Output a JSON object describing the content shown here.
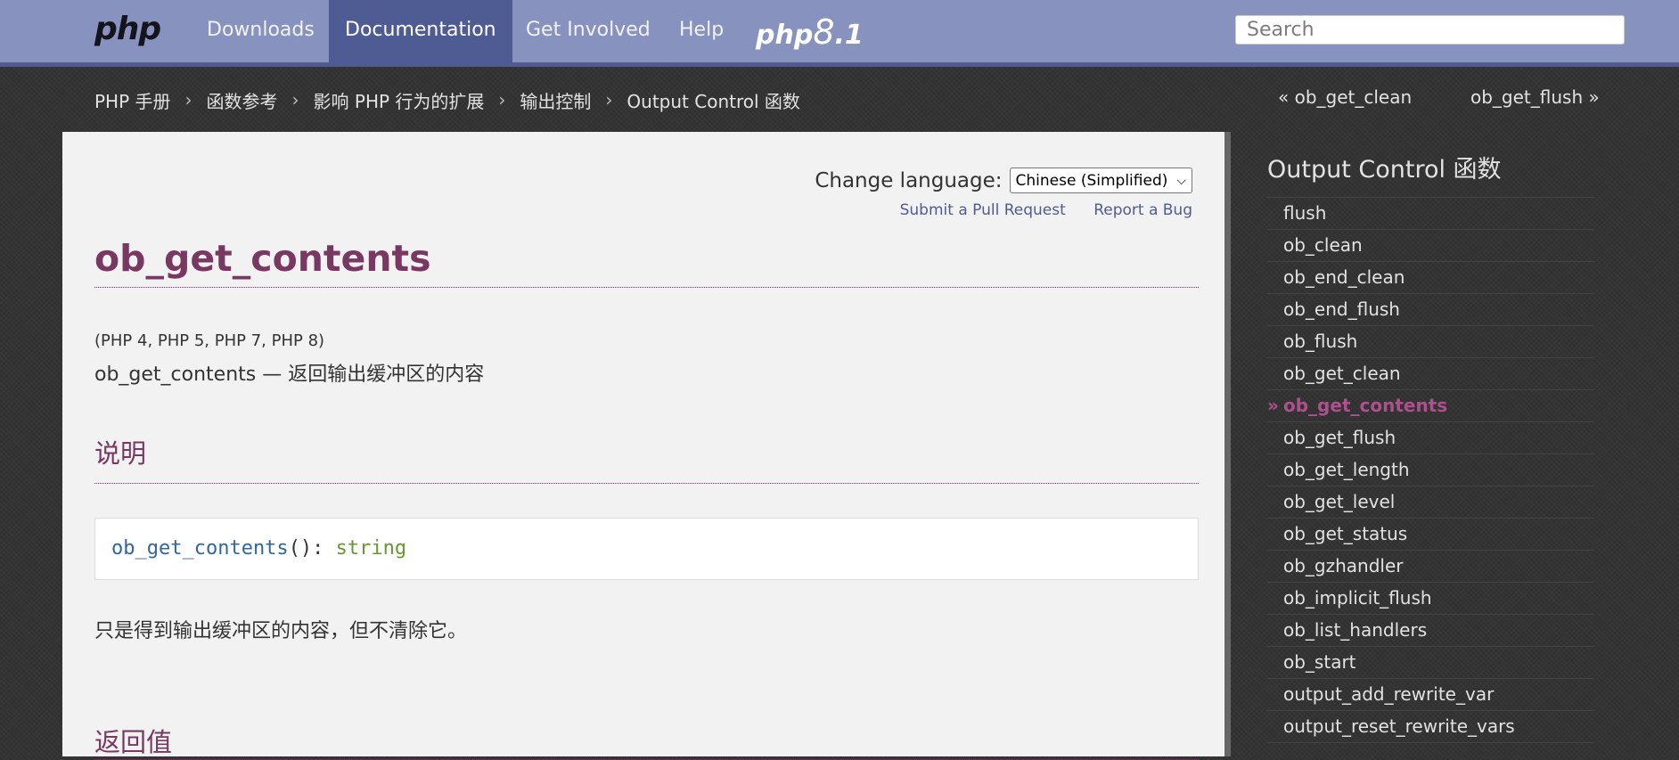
{
  "nav": {
    "logo": "php",
    "links": [
      "Downloads",
      "Documentation",
      "Get Involved",
      "Help"
    ],
    "php_version_left": "php",
    "php_version_big": "8",
    "php_version_right": ".1",
    "search_placeholder": "Search"
  },
  "breadcrumb": {
    "items": [
      "PHP 手册",
      "函数参考",
      "影响 PHP 行为的扩展",
      "输出控制",
      "Output Control 函数"
    ],
    "separator": "›",
    "prev": "« ob_get_clean",
    "next": "ob_get_flush »"
  },
  "content": {
    "change_language_label": "Change language:",
    "language_selected": "Chinese (Simplified)",
    "submit_pr": "Submit a Pull Request",
    "report_bug": "Report a Bug",
    "title": "ob_get_contents",
    "versions": "(PHP 4, PHP 5, PHP 7, PHP 8)",
    "refpurpose": "ob_get_contents — 返回输出缓冲区的内容",
    "h_description": "说明",
    "synopsis_fn": "ob_get_contents",
    "synopsis_parens": "(): ",
    "synopsis_type": "string",
    "description_para": "只是得到输出缓冲区的内容，但不清除它。",
    "h_return": "返回值"
  },
  "sidebar": {
    "title": "Output Control 函数",
    "current_marker": "»",
    "items": [
      "flush",
      "ob_clean",
      "ob_end_clean",
      "ob_end_flush",
      "ob_flush",
      "ob_get_clean",
      "ob_get_contents",
      "ob_get_flush",
      "ob_get_length",
      "ob_get_level",
      "ob_get_status",
      "ob_gzhandler",
      "ob_implicit_flush",
      "ob_list_handlers",
      "ob_start",
      "output_add_rewrite_var",
      "output_reset_rewrite_vars"
    ],
    "current_index": 6
  },
  "colors": {
    "nav_bg": "#8892bf",
    "nav_active": "#4f5b93",
    "title_color": "#793862",
    "current_item": "#ae508d",
    "type_color": "#693",
    "fn_color": "#369"
  }
}
